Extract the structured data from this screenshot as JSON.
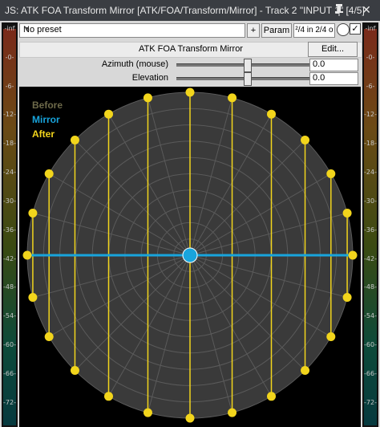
{
  "window": {
    "title": "JS: ATK FOA Transform Mirror [ATK/FOA/Transform/Mirror] - Track 2 \"INPUT 1\" [4/5]",
    "pin_icon": "pin-icon",
    "close_icon": "close-icon"
  },
  "meters": {
    "left_ticks": [
      "-inf",
      "-0-",
      "-6-",
      "-12-",
      "-18-",
      "-24-",
      "-30-",
      "-36-",
      "-42-",
      "-48-",
      "-54-",
      "-60-",
      "-66-",
      "-72-"
    ],
    "right_ticks": [
      "-inf",
      "-0-",
      "-6-",
      "-12-",
      "-18-",
      "-24-",
      "-30-",
      "-36-",
      "-42-",
      "-48-",
      "-54-",
      "-60-",
      "-66-",
      "-72-"
    ]
  },
  "toolbar": {
    "preset": "No preset",
    "plus_label": "+",
    "param_label": "Param",
    "io_label": "²/4 in 2/4 o"
  },
  "plugin": {
    "name": "ATK FOA Transform Mirror",
    "edit_label": "Edit..."
  },
  "params": {
    "azimuth": {
      "label": "Azimuth (mouse)",
      "value": "0.0",
      "fraction": 0.5
    },
    "elevation": {
      "label": "Elevation",
      "value": "0.0",
      "fraction": 0.5
    }
  },
  "display": {
    "legend_before": "Before",
    "legend_mirror": "Mirror",
    "legend_after": "After",
    "colors": {
      "before": "#6e6a4a",
      "mirror": "#18a4dc",
      "after": "#f2d51c",
      "grid": "#5a5a5a",
      "disk": "#3a3a3a"
    }
  }
}
